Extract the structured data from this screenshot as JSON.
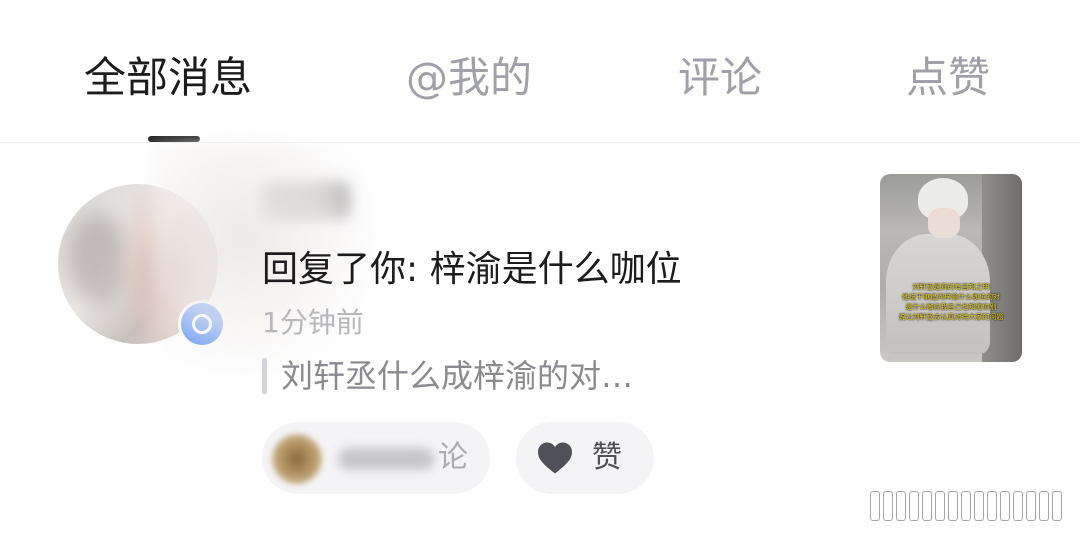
{
  "tabs": [
    {
      "label": "全部消息",
      "active": true
    },
    {
      "label": "@我的",
      "active": false
    },
    {
      "label": "评论",
      "active": false
    },
    {
      "label": "点赞",
      "active": false
    }
  ],
  "message": {
    "reply_text": "回复了你: 梓渝是什么咖位",
    "time": "1分钟前",
    "quote": "刘轩丞什么成梓渝的对…",
    "comment_label": "论",
    "like_label": "赞",
    "thumbnail_caption": [
      "刘轩丞是真的有自知之明",
      "他说干嘛追问梓渝什么咖位的对",
      "是什么咖位我自己也知道你别",
      "说让刘轩丞去认真对待大家的问题"
    ]
  },
  "colors": {
    "text_primary": "#1c1c1e",
    "text_tab_inactive": "#a0a0a8",
    "text_muted": "#8a8a90",
    "pill_bg": "#f4f4f6",
    "verified_badge": "#3f7cf2",
    "like_heart": "#505058"
  },
  "icons": {
    "verified_badge": "verified-badge-icon",
    "like": "heart-icon"
  }
}
